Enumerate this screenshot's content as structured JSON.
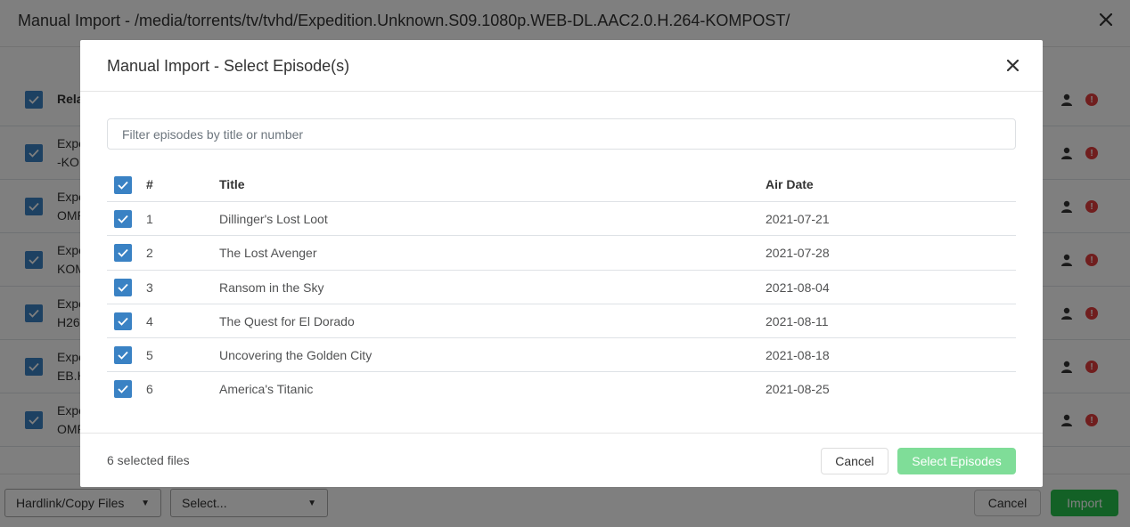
{
  "background": {
    "title": "Manual Import - /media/torrents/tv/tvhd/Expedition.Unknown.S09.1080p.WEB-DL.AAC2.0.H.264-KOMPOST/",
    "close_icon": "close-icon",
    "header_row_label": "Rela",
    "rows": [
      {
        "line1": "Expe",
        "line2": "-KOM"
      },
      {
        "line1": "Expe",
        "line2": "OMP"
      },
      {
        "line1": "Expe",
        "line2": "KOM"
      },
      {
        "line1": "Expe",
        "line2": "H26"
      },
      {
        "line1": "Expe",
        "line2": "EB.H"
      },
      {
        "line1": "Expe",
        "line2": "OMP"
      }
    ],
    "footer": {
      "mode_select": "Hardlink/Copy Files",
      "second_select": "Select...",
      "cancel_label": "Cancel",
      "import_label": "Import"
    }
  },
  "modal": {
    "title": "Manual Import - Select Episode(s)",
    "filter_placeholder": "Filter episodes by title or number",
    "columns": {
      "number": "#",
      "title": "Title",
      "air_date": "Air Date"
    },
    "episodes": [
      {
        "number": "1",
        "title": "Dillinger's Lost Loot",
        "air_date": "2021-07-21"
      },
      {
        "number": "2",
        "title": "The Lost Avenger",
        "air_date": "2021-07-28"
      },
      {
        "number": "3",
        "title": "Ransom in the Sky",
        "air_date": "2021-08-04"
      },
      {
        "number": "4",
        "title": "The Quest for El Dorado",
        "air_date": "2021-08-11"
      },
      {
        "number": "5",
        "title": "Uncovering the Golden City",
        "air_date": "2021-08-18"
      },
      {
        "number": "6",
        "title": "America's Titanic",
        "air_date": "2021-08-25"
      }
    ],
    "selected_count": "6 selected files",
    "cancel_label": "Cancel",
    "select_label": "Select Episodes"
  },
  "colors": {
    "checkbox": "#3a82c4",
    "primary_disabled": "#7fdd98",
    "import": "#27c24c",
    "alert": "#e03c3c"
  }
}
